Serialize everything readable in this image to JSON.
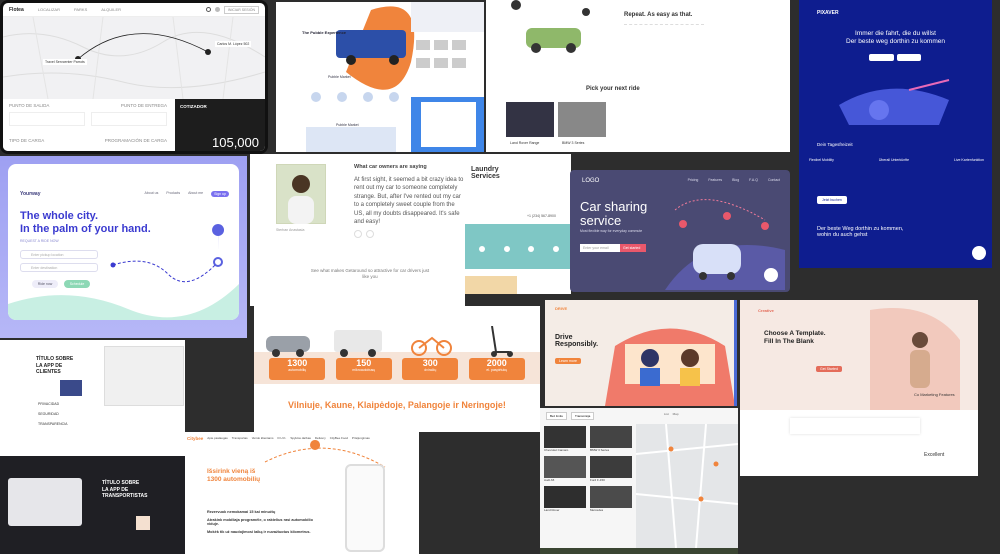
{
  "t1": {
    "logo": "Flotea",
    "nav": [
      "LOCALIZAR",
      "PARKS",
      "ALQUILER"
    ],
    "login": "INICIAR SESIÓN",
    "origin": "Travel Servcenter Parrots",
    "dest": "Carlos M. López 502",
    "panel_head_a": "PUNTO DE SALIDA",
    "panel_head_b": "PUNTO DE ENTREGA",
    "panel_foot_a": "TIPO DE CARGA",
    "panel_foot_b": "PROGRAMACIÓN DE CARGA",
    "dark_title": "COTIZADOR",
    "price": "105,000"
  },
  "t2": {
    "title": "The Pubble Experience",
    "sub": "Pubble Market",
    "footer": "Pubble Market"
  },
  "t3": {
    "heading": "Repeat. As easy as that.",
    "pick": "Pick your next ride",
    "car_a": "Land Rover Range",
    "car_b": "BMW 3 Series"
  },
  "t4": {
    "logo": "PIXAVER",
    "headline": "Immer die fahrt, die du willst\nDer beste weg dorthin zu kommen",
    "sub": "Dein Tagesfreizeit",
    "features": [
      "Flexibel Mobility",
      "Überall Unterkünfte",
      "Live Kartenfunktion"
    ],
    "cta": "Jetzt buchen",
    "bottom": "Der beste Weg dorthin zu kommen,\nwohin du auch gehst"
  },
  "t5": {
    "logo": "Yourway",
    "nav": [
      "About us",
      "Products",
      "About me"
    ],
    "nav_btn": "Sign up",
    "h1": "The whole city.\nIn the palm of your hand.",
    "sub": "REQUEST A RIDE NOW",
    "pickup": "Enter pickup location",
    "dropoff": "Enter destination",
    "btn_a": "Ride now",
    "btn_b": "Schedule"
  },
  "t6": {
    "heading": "What car owners are saying",
    "quote": "At first sight, it seemed a bit crazy idea to rent out my car to someone completely strange. But, after I've rented out my car to a completely sweet couple from the US, all my doubts disappeared. It's safe and easy!",
    "caption": "Sterban Anastasia",
    "footer": "See what makes Getaround so attractive for car drivers just like you"
  },
  "t7": {
    "title": "Laundry\nServices",
    "phone": "+1 (234) 567-8900"
  },
  "t8": {
    "logo": "LOGO",
    "nav": [
      "Pricing",
      "Features",
      "Blog",
      "F.A.Q",
      "Contact"
    ],
    "h1": "Car sharing\nservice",
    "sub": "Most flexible way for everyday commute",
    "input": "Enter your email",
    "btn": "Get started"
  },
  "t9": {
    "h1": "TÍTULO SOBRE\nLA APP DE\nCLIENTES",
    "h2": "TÍTULO SOBRE\nLA APP DE\nTRANSPORTISTAS",
    "items": [
      "PRIVACIDAD",
      "SEGURIDAD",
      "TRANSPARENCIA"
    ]
  },
  "t10": {
    "stats": [
      {
        "num": "1300",
        "label": "automobilių"
      },
      {
        "num": "150",
        "label": "mikroautobusų"
      },
      {
        "num": "300",
        "label": "dviračių"
      },
      {
        "num": "2000",
        "label": "el. paspirtukų"
      }
    ],
    "cities": "Vilniuje, Kaune, Klaipėdoje, Palangoje ir Neringoje!"
  },
  "t11": {
    "logo": "DRIVE",
    "h1": "Drive\nResponsibly.",
    "btn": "Learn more"
  },
  "t12": {
    "logo": "Creative",
    "h1": "Choose A Template.\nFill In The Blank",
    "cta": "Get Started",
    "mid": "Co Marketing Features",
    "bottom": "Excellent"
  },
  "t13": {
    "logo": "Citybee",
    "nav": [
      "Apie paslaugas",
      "Transportas",
      "Verslo klientams",
      "D.U.K.",
      "Spyklos darbas",
      "Delivery",
      "CityBee Food"
    ],
    "nav_btn": "Prisijungimas",
    "h1": "Išsirink vieną iš\n1300 automobilių",
    "items": [
      "Rezervuok nemokamai 15 kai minučių",
      "Atrakink mobiliaja programėle, o raktelius rasi automobilio viduje.",
      "Mokėk tik už naudojimosi laiką ir nuvažiuotus kilometrus."
    ]
  },
  "t14": {
    "filters": [
      "Bez limitu",
      "Transmisija"
    ],
    "toggles": [
      "List",
      "Map"
    ],
    "cars": [
      "Chevrolet Camaro",
      "BMW 3 Series",
      "Audi A5",
      "Ford F-150",
      "Land Rover",
      "Mercedes"
    ]
  },
  "colors": {
    "orange": "#f0843c",
    "navy": "#0e1d8f",
    "lavender": "#a5a6f5",
    "dark": "#1d1d1d"
  }
}
